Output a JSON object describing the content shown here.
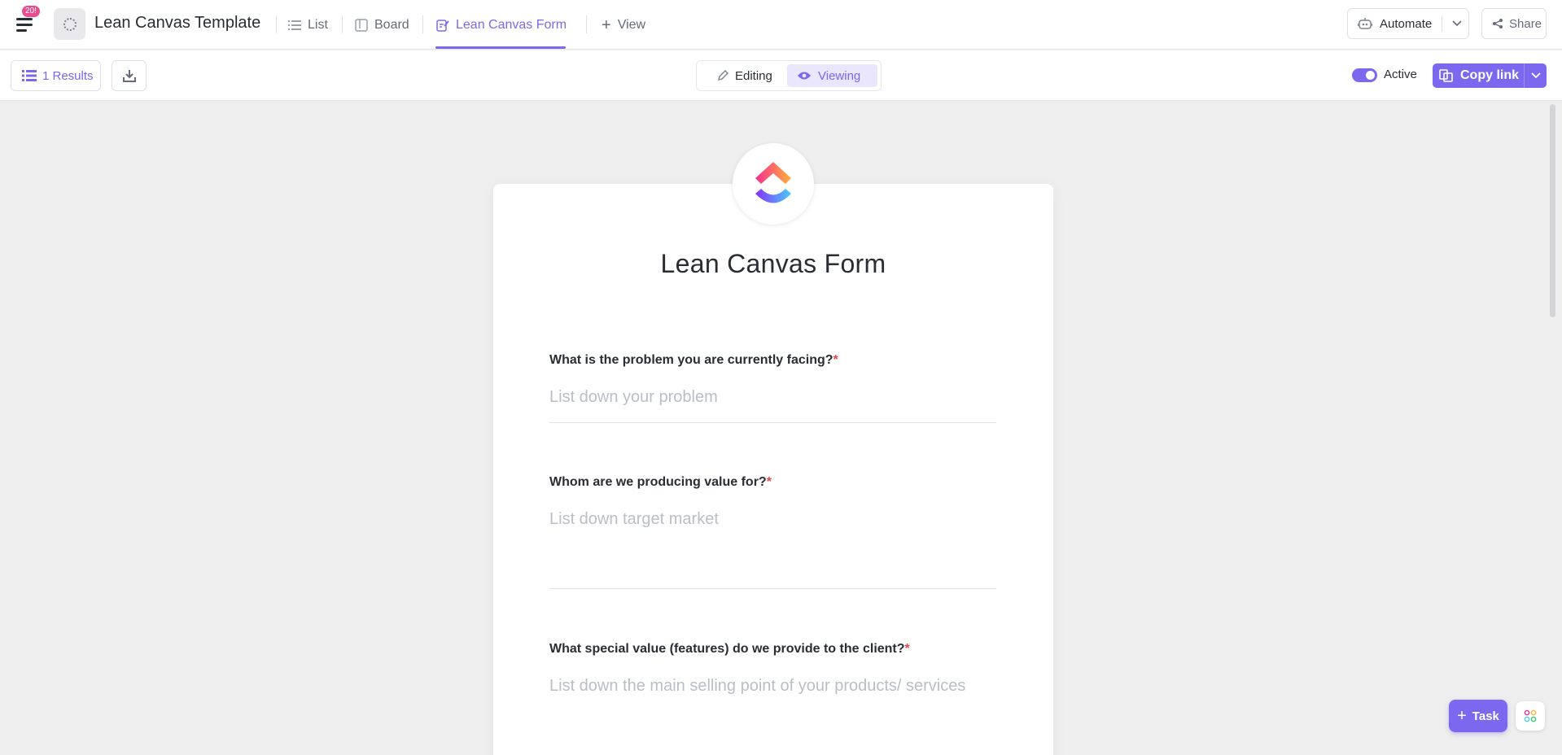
{
  "header": {
    "notification_count": "20!",
    "page_title": "Lean Canvas Template",
    "tabs": [
      {
        "label": "List",
        "icon": "list-icon"
      },
      {
        "label": "Board",
        "icon": "board-icon"
      },
      {
        "label": "Lean Canvas Form",
        "icon": "form-icon",
        "active": true
      }
    ],
    "add_view_label": "View",
    "automate_label": "Automate",
    "share_label": "Share"
  },
  "toolbar": {
    "results_label": "1 Results",
    "mode_editing": "Editing",
    "mode_viewing": "Viewing",
    "active_mode": "Viewing",
    "active_toggle_label": "Active",
    "active_toggle_on": true,
    "copy_link_label": "Copy link"
  },
  "form": {
    "title": "Lean Canvas Form",
    "required_marker": "*",
    "fields": [
      {
        "question": "What is the problem you are currently facing?",
        "placeholder": "List down your problem"
      },
      {
        "question": "Whom are we producing value for?",
        "placeholder": "List down target market"
      },
      {
        "question": "What special value (features) do we provide to the client?",
        "placeholder": "List down the main selling point of your products/ services"
      }
    ]
  },
  "fab": {
    "task_label": "Task"
  },
  "colors": {
    "accent": "#7b68ee",
    "required": "#e5484d",
    "badge": "#e94c8f",
    "canvas_bg": "#efefef"
  }
}
